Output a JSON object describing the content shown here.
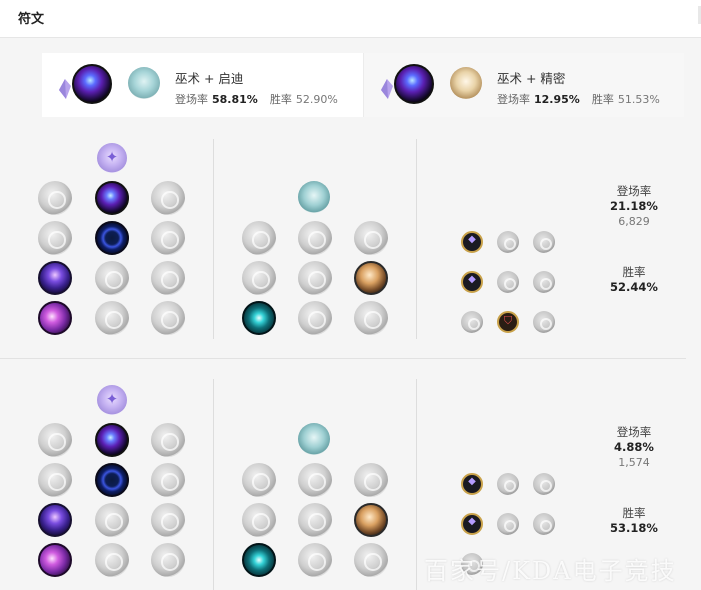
{
  "header": {
    "title": "符文"
  },
  "summary": [
    {
      "title": "巫术 + 启迪",
      "pick_label": "登场率",
      "pick": "58.81%",
      "wr_label": "胜率",
      "wr": "52.90%"
    },
    {
      "title": "巫术 + 精密",
      "pick_label": "登场率",
      "pick": "12.95%",
      "wr_label": "胜率",
      "wr": "51.53%"
    }
  ],
  "builds": [
    {
      "pick_label": "登场率",
      "pick": "21.18%",
      "count": "6,829",
      "wr_label": "胜率",
      "wr": "52.44%"
    },
    {
      "pick_label": "登场率",
      "pick": "4.88%",
      "count": "1,574",
      "wr_label": "胜率",
      "wr": "53.18%"
    }
  ],
  "watermark": "百家号/KDA电子竞技"
}
